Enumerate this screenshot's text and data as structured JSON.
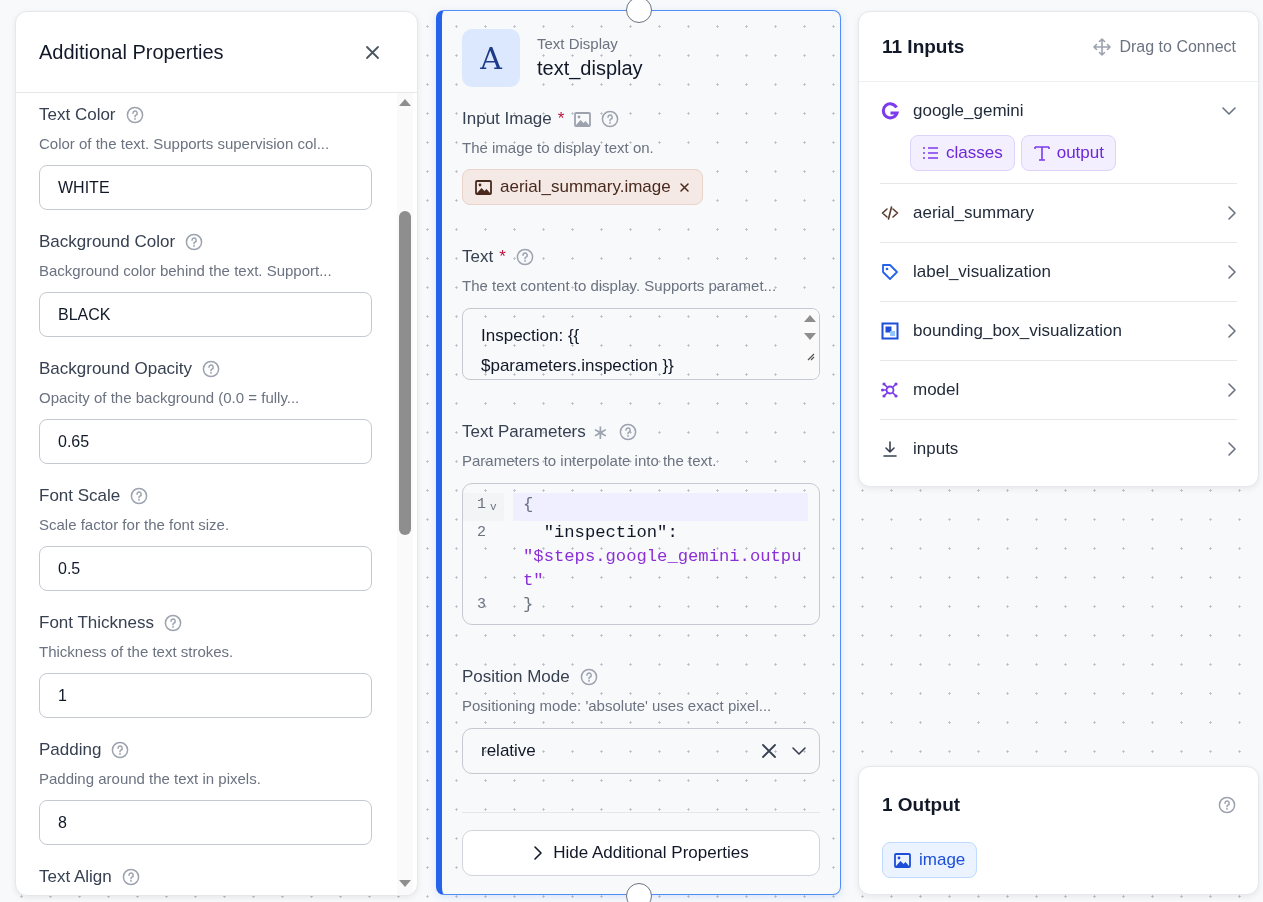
{
  "properties_panel": {
    "title": "Additional Properties",
    "fields": [
      {
        "label": "Text Color",
        "description": "Color of the text. Supports supervision col...",
        "value": "WHITE"
      },
      {
        "label": "Background Color",
        "description": "Background color behind the text. Support...",
        "value": "BLACK"
      },
      {
        "label": "Background Opacity",
        "description": "Opacity of the background (0.0 = fully...",
        "value": "0.65"
      },
      {
        "label": "Font Scale",
        "description": "Scale factor for the font size.",
        "value": "0.5"
      },
      {
        "label": "Font Thickness",
        "description": "Thickness of the text strokes.",
        "value": "1"
      },
      {
        "label": "Padding",
        "description": "Padding around the text in pixels.",
        "value": "8"
      },
      {
        "label": "Text Align"
      }
    ]
  },
  "block": {
    "icon_letter": "A",
    "type": "Text Display",
    "name": "text_display",
    "fields": [
      {
        "kind": "image",
        "label": "Input Image",
        "mark": "*",
        "required": true,
        "description": "The image to display text on.",
        "chips": [
          "aerial_summary.image"
        ]
      },
      {
        "kind": "textarea",
        "label": "Text",
        "mark": "*",
        "required": true,
        "description": "The text content to display. Supports paramet...",
        "value": "Inspection: {{ $parameters.inspection }}"
      },
      {
        "kind": "code",
        "label": "Text Parameters",
        "mark": "∗",
        "required": false,
        "description": "Parameters to interpolate into the text.",
        "lines": [
          {
            "number": "1",
            "fold": "v",
            "highlighted": true,
            "tokens": [
              {
                "kind": "punct",
                "text": "{"
              }
            ]
          },
          {
            "number": "2",
            "highlighted": false,
            "tokens": [
              {
                "kind": "key",
                "text": "  \"inspection\": "
              },
              {
                "kind": "string",
                "text": "\"$steps.google_gemini.output\""
              }
            ]
          },
          {
            "number": "3",
            "highlighted": false,
            "tokens": [
              {
                "kind": "punct",
                "text": "}"
              }
            ]
          }
        ]
      },
      {
        "kind": "select",
        "label": "Position Mode",
        "description": "Positioning mode: 'absolute' uses exact pixel...",
        "value": "relative"
      }
    ],
    "toggle_button": "Hide Additional Properties"
  },
  "inputs_panel": {
    "title": "11 Inputs",
    "hint": "Drag to Connect",
    "items": [
      {
        "kind": "llm",
        "name": "google_gemini",
        "expanded": true,
        "outputs": [
          {
            "kind": "list",
            "label": "classes"
          },
          {
            "kind": "text",
            "label": "output"
          }
        ]
      },
      {
        "kind": "code",
        "name": "aerial_summary",
        "expanded": false
      },
      {
        "kind": "label",
        "name": "label_visualization",
        "expanded": false
      },
      {
        "kind": "bbox",
        "name": "bounding_box_visualization",
        "expanded": false
      },
      {
        "kind": "model",
        "name": "model",
        "expanded": false
      },
      {
        "kind": "inputs",
        "name": "inputs",
        "expanded": false
      }
    ]
  },
  "outputs_panel": {
    "title": "1 Output",
    "outputs": [
      {
        "kind": "image",
        "label": "image"
      }
    ]
  }
}
